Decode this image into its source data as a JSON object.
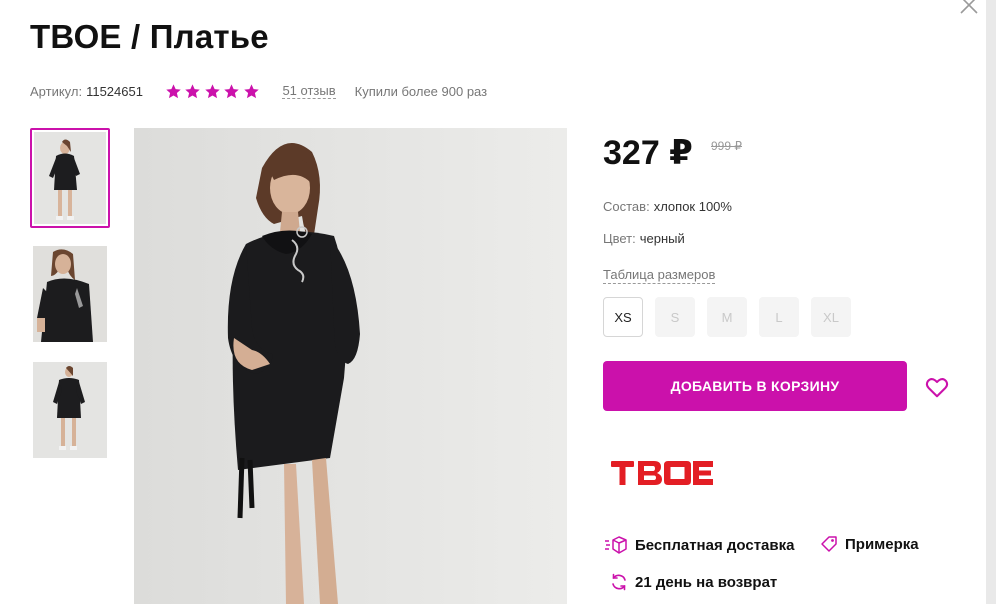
{
  "product": {
    "title": "ТВОЕ / Платье",
    "article_label": "Артикул:",
    "article_value": "11524651",
    "rating_stars": 5,
    "reviews_text": "51 отзыв",
    "bought_text": "Купили более 900 раз"
  },
  "price": {
    "current": "327 ₽",
    "old": "999 ₽"
  },
  "specs": {
    "composition_label": "Состав:",
    "composition_value": "хлопок 100%",
    "color_label": "Цвет:",
    "color_value": "черный"
  },
  "sizes": {
    "table_link": "Таблица размеров",
    "items": [
      {
        "label": "XS",
        "available": true
      },
      {
        "label": "S",
        "available": false
      },
      {
        "label": "M",
        "available": false
      },
      {
        "label": "L",
        "available": false
      },
      {
        "label": "XL",
        "available": false
      }
    ]
  },
  "actions": {
    "add_to_cart": "ДОБАВИТЬ В КОРЗИНУ"
  },
  "brand": {
    "logo_text": "ТВОЕ",
    "logo_color": "#e31e24"
  },
  "features": {
    "delivery": "Бесплатная доставка",
    "fitting": "Примерка",
    "return": "21 день на возврат"
  },
  "icons": {
    "close": "close-icon",
    "star": "star-icon",
    "heart": "heart-icon",
    "delivery": "delivery-box-icon",
    "fitting": "tag-icon",
    "return": "refresh-icon"
  },
  "colors": {
    "accent": "#cb11ab",
    "star": "#cb11ab",
    "brand_red": "#e31e24"
  }
}
